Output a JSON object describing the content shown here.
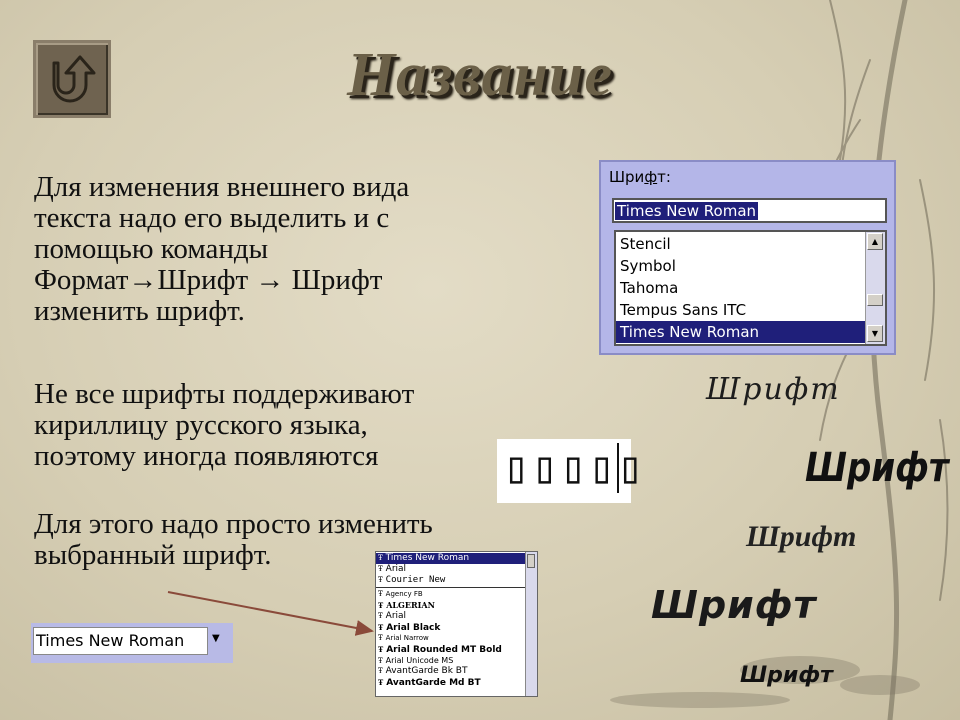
{
  "title": "Название",
  "paragraphs": {
    "p1_line1": "Для изменения внешнего вида",
    "p1_line2": "текста надо его выделить и с",
    "p1_line3": "помощью команды",
    "p1_format": "Формат",
    "p1_font1": "Шрифт",
    "p1_font2": "Шрифт",
    "p1_line5": "изменить шрифт.",
    "p2_line1": "Не все шрифты поддерживают",
    "p2_line2": "кириллицу русского языка,",
    "p2_line3": "поэтому иногда появляются",
    "p3_line1": "Для этого надо просто изменить",
    "p3_line2": "выбранный шрифт."
  },
  "font_dialog": {
    "label_prefix": "Шри",
    "label_underlined": "ф",
    "label_suffix": "т:",
    "input_value": "Times New Roman",
    "items": [
      "Stencil",
      "Symbol",
      "Tahoma",
      "Tempus Sans ITC",
      "Times New Roman"
    ],
    "selected_index": 4
  },
  "boxes_text": "▯▯▯▯▯",
  "samples": [
    "Шрифт",
    "Шрифт",
    "Шрифт",
    "Шрифт",
    "Шрифт"
  ],
  "combo": {
    "value": "Times New Roman"
  },
  "font_list": {
    "items": [
      "Times New Roman",
      "Arial",
      "Courier New",
      "Agency FB",
      "ALGERIAN",
      "Arial",
      "Arial Black",
      "Arial Narrow",
      "Arial Rounded MT Bold",
      "Arial Unicode MS",
      "AvantGarde Bk BT",
      "AvantGarde Md BT"
    ],
    "selected_index": 0
  },
  "colors": {
    "selection": "#1f1f7a",
    "dialog_bg": "#b4b6e8",
    "arrow": "#8a4a3a"
  },
  "icons": {
    "back": "u-turn-arrow-icon",
    "truetype": "truetype-icon"
  }
}
